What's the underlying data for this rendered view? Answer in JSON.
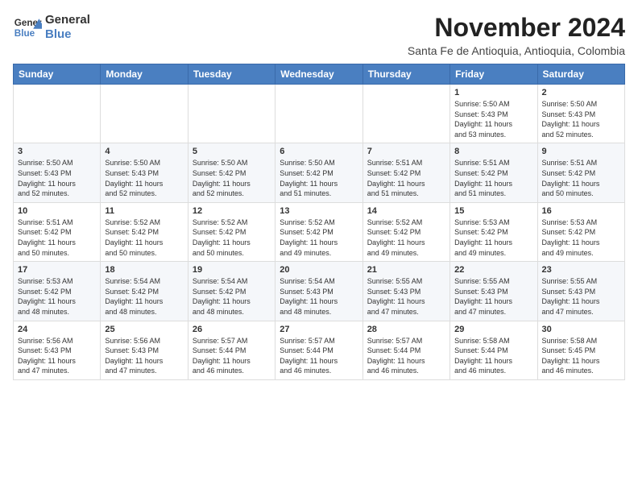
{
  "header": {
    "logo_general": "General",
    "logo_blue": "Blue",
    "title": "November 2024",
    "subtitle": "Santa Fe de Antioquia, Antioquia, Colombia"
  },
  "calendar": {
    "days_of_week": [
      "Sunday",
      "Monday",
      "Tuesday",
      "Wednesday",
      "Thursday",
      "Friday",
      "Saturday"
    ],
    "weeks": [
      [
        {
          "day": "",
          "info": ""
        },
        {
          "day": "",
          "info": ""
        },
        {
          "day": "",
          "info": ""
        },
        {
          "day": "",
          "info": ""
        },
        {
          "day": "",
          "info": ""
        },
        {
          "day": "1",
          "info": "Sunrise: 5:50 AM\nSunset: 5:43 PM\nDaylight: 11 hours\nand 53 minutes."
        },
        {
          "day": "2",
          "info": "Sunrise: 5:50 AM\nSunset: 5:43 PM\nDaylight: 11 hours\nand 52 minutes."
        }
      ],
      [
        {
          "day": "3",
          "info": "Sunrise: 5:50 AM\nSunset: 5:43 PM\nDaylight: 11 hours\nand 52 minutes."
        },
        {
          "day": "4",
          "info": "Sunrise: 5:50 AM\nSunset: 5:43 PM\nDaylight: 11 hours\nand 52 minutes."
        },
        {
          "day": "5",
          "info": "Sunrise: 5:50 AM\nSunset: 5:42 PM\nDaylight: 11 hours\nand 52 minutes."
        },
        {
          "day": "6",
          "info": "Sunrise: 5:50 AM\nSunset: 5:42 PM\nDaylight: 11 hours\nand 51 minutes."
        },
        {
          "day": "7",
          "info": "Sunrise: 5:51 AM\nSunset: 5:42 PM\nDaylight: 11 hours\nand 51 minutes."
        },
        {
          "day": "8",
          "info": "Sunrise: 5:51 AM\nSunset: 5:42 PM\nDaylight: 11 hours\nand 51 minutes."
        },
        {
          "day": "9",
          "info": "Sunrise: 5:51 AM\nSunset: 5:42 PM\nDaylight: 11 hours\nand 50 minutes."
        }
      ],
      [
        {
          "day": "10",
          "info": "Sunrise: 5:51 AM\nSunset: 5:42 PM\nDaylight: 11 hours\nand 50 minutes."
        },
        {
          "day": "11",
          "info": "Sunrise: 5:52 AM\nSunset: 5:42 PM\nDaylight: 11 hours\nand 50 minutes."
        },
        {
          "day": "12",
          "info": "Sunrise: 5:52 AM\nSunset: 5:42 PM\nDaylight: 11 hours\nand 50 minutes."
        },
        {
          "day": "13",
          "info": "Sunrise: 5:52 AM\nSunset: 5:42 PM\nDaylight: 11 hours\nand 49 minutes."
        },
        {
          "day": "14",
          "info": "Sunrise: 5:52 AM\nSunset: 5:42 PM\nDaylight: 11 hours\nand 49 minutes."
        },
        {
          "day": "15",
          "info": "Sunrise: 5:53 AM\nSunset: 5:42 PM\nDaylight: 11 hours\nand 49 minutes."
        },
        {
          "day": "16",
          "info": "Sunrise: 5:53 AM\nSunset: 5:42 PM\nDaylight: 11 hours\nand 49 minutes."
        }
      ],
      [
        {
          "day": "17",
          "info": "Sunrise: 5:53 AM\nSunset: 5:42 PM\nDaylight: 11 hours\nand 48 minutes."
        },
        {
          "day": "18",
          "info": "Sunrise: 5:54 AM\nSunset: 5:42 PM\nDaylight: 11 hours\nand 48 minutes."
        },
        {
          "day": "19",
          "info": "Sunrise: 5:54 AM\nSunset: 5:42 PM\nDaylight: 11 hours\nand 48 minutes."
        },
        {
          "day": "20",
          "info": "Sunrise: 5:54 AM\nSunset: 5:43 PM\nDaylight: 11 hours\nand 48 minutes."
        },
        {
          "day": "21",
          "info": "Sunrise: 5:55 AM\nSunset: 5:43 PM\nDaylight: 11 hours\nand 47 minutes."
        },
        {
          "day": "22",
          "info": "Sunrise: 5:55 AM\nSunset: 5:43 PM\nDaylight: 11 hours\nand 47 minutes."
        },
        {
          "day": "23",
          "info": "Sunrise: 5:55 AM\nSunset: 5:43 PM\nDaylight: 11 hours\nand 47 minutes."
        }
      ],
      [
        {
          "day": "24",
          "info": "Sunrise: 5:56 AM\nSunset: 5:43 PM\nDaylight: 11 hours\nand 47 minutes."
        },
        {
          "day": "25",
          "info": "Sunrise: 5:56 AM\nSunset: 5:43 PM\nDaylight: 11 hours\nand 47 minutes."
        },
        {
          "day": "26",
          "info": "Sunrise: 5:57 AM\nSunset: 5:44 PM\nDaylight: 11 hours\nand 46 minutes."
        },
        {
          "day": "27",
          "info": "Sunrise: 5:57 AM\nSunset: 5:44 PM\nDaylight: 11 hours\nand 46 minutes."
        },
        {
          "day": "28",
          "info": "Sunrise: 5:57 AM\nSunset: 5:44 PM\nDaylight: 11 hours\nand 46 minutes."
        },
        {
          "day": "29",
          "info": "Sunrise: 5:58 AM\nSunset: 5:44 PM\nDaylight: 11 hours\nand 46 minutes."
        },
        {
          "day": "30",
          "info": "Sunrise: 5:58 AM\nSunset: 5:45 PM\nDaylight: 11 hours\nand 46 minutes."
        }
      ]
    ]
  }
}
